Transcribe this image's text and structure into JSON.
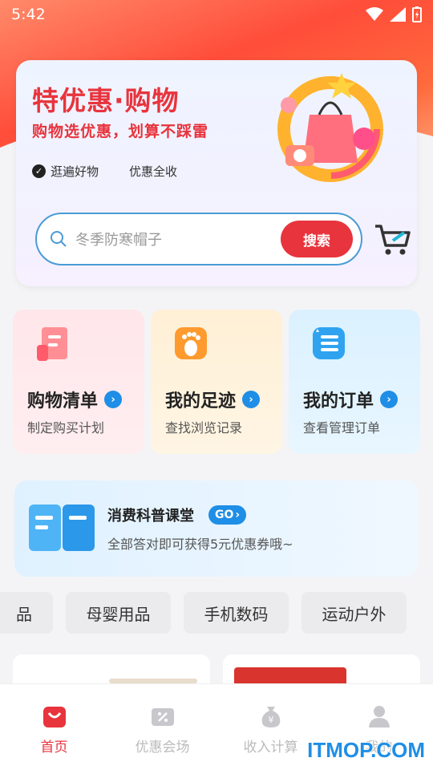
{
  "status_bar": {
    "time": "5:42"
  },
  "hero": {
    "title": "特优惠·购物",
    "subtitle": "购物选优惠，划算不踩雷",
    "tags": [
      "逛遍好物",
      "优惠全收"
    ]
  },
  "search": {
    "placeholder": "冬季防寒帽子",
    "button_label": "搜索"
  },
  "cards": [
    {
      "title": "购物清单",
      "subtitle": "制定购买计划",
      "icon": "list-icon"
    },
    {
      "title": "我的足迹",
      "subtitle": "查找浏览记录",
      "icon": "footprint-icon"
    },
    {
      "title": "我的订单",
      "subtitle": "查看管理订单",
      "icon": "order-icon"
    }
  ],
  "banner": {
    "title": "消费科普课堂",
    "go_label": "GO",
    "subtitle": "全部答对即可获得5元优惠券哦~"
  },
  "categories": [
    "品",
    "母婴用品",
    "手机数码",
    "运动户外"
  ],
  "bottom_nav": [
    {
      "label": "首页",
      "active": true
    },
    {
      "label": "优惠会场",
      "active": false
    },
    {
      "label": "收入计算",
      "active": false
    },
    {
      "label": "我的",
      "active": false
    }
  ],
  "watermark": "ITMOP.COM",
  "colors": {
    "accent": "#e8343d",
    "blue": "#1f8ee6"
  }
}
